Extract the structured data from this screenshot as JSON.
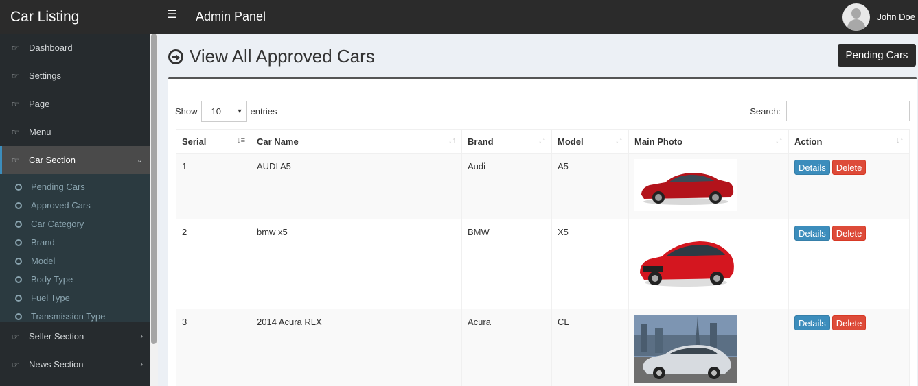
{
  "app": {
    "brand": "Car Listing",
    "panel_title": "Admin Panel",
    "user_name": "John Doe"
  },
  "sidebar": {
    "items": [
      {
        "label": "Dashboard",
        "icon": "hand-point-icon"
      },
      {
        "label": "Settings",
        "icon": "hand-point-icon"
      },
      {
        "label": "Page",
        "icon": "hand-point-icon"
      },
      {
        "label": "Menu",
        "icon": "hand-point-icon"
      },
      {
        "label": "Car Section",
        "icon": "hand-point-icon",
        "active": true
      },
      {
        "label": "Seller Section",
        "icon": "hand-point-icon"
      },
      {
        "label": "News Section",
        "icon": "hand-point-icon"
      }
    ],
    "car_section_sub": [
      "Pending Cars",
      "Approved Cars",
      "Car Category",
      "Brand",
      "Model",
      "Body Type",
      "Fuel Type",
      "Transmission Type"
    ]
  },
  "page": {
    "title": "View All Approved Cars",
    "pending_button": "Pending Cars"
  },
  "table_controls": {
    "show_label": "Show",
    "entries_label": "entries",
    "page_size": "10",
    "search_label": "Search:"
  },
  "table": {
    "headers": [
      "Serial",
      "Car Name",
      "Brand",
      "Model",
      "Main Photo",
      "Action"
    ],
    "rows": [
      {
        "serial": "1",
        "name": "AUDI A5",
        "brand": "Audi",
        "model": "A5",
        "photo": "red-sedan"
      },
      {
        "serial": "2",
        "name": "bmw x5",
        "brand": "BMW",
        "model": "X5",
        "photo": "red-hatchback"
      },
      {
        "serial": "3",
        "name": "2014 Acura RLX",
        "brand": "Acura",
        "model": "CL",
        "photo": "silver-sedan-city"
      }
    ],
    "actions": {
      "details": "Details",
      "delete": "Delete"
    }
  },
  "colors": {
    "topbar": "#2b2b2b",
    "sidebar": "#262b2e",
    "details": "#3c8dbc",
    "delete": "#dd4b39"
  }
}
